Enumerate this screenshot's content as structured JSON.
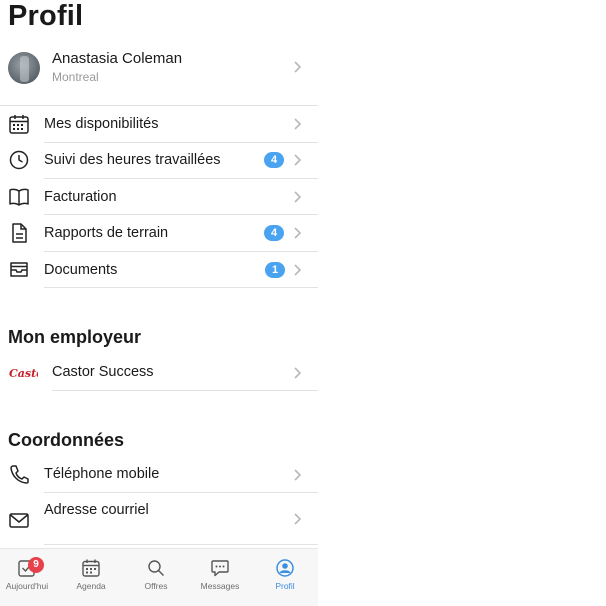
{
  "page": {
    "title": "Profil"
  },
  "profile": {
    "name": "Anastasia Coleman",
    "city": "Montreal"
  },
  "menu": [
    {
      "label": "Mes disponibilités",
      "icon": "calendar-icon",
      "badge": null
    },
    {
      "label": "Suivi des heures travaillées",
      "icon": "clock-icon",
      "badge": "4"
    },
    {
      "label": "Facturation",
      "icon": "book-icon",
      "badge": null
    },
    {
      "label": "Rapports de terrain",
      "icon": "document-icon",
      "badge": "4"
    },
    {
      "label": "Documents",
      "icon": "inbox-icon",
      "badge": "1"
    }
  ],
  "employer": {
    "heading": "Mon employeur",
    "name": "Castor Success",
    "logo_text": "Castor"
  },
  "contact": {
    "heading": "Coordonnées",
    "items": [
      {
        "label": "Téléphone mobile",
        "icon": "phone-icon"
      },
      {
        "label": "Adresse courriel",
        "icon": "mail-icon"
      }
    ]
  },
  "tabbar": {
    "tabs": [
      {
        "label": "Aujourd'hui",
        "icon": "checkbox-icon",
        "badge": "9",
        "active": false
      },
      {
        "label": "Agenda",
        "icon": "calendar-icon",
        "active": false
      },
      {
        "label": "Offres",
        "icon": "search-icon",
        "active": false
      },
      {
        "label": "Messages",
        "icon": "chat-icon",
        "active": false
      },
      {
        "label": "Profil",
        "icon": "profile-icon",
        "active": true
      }
    ]
  },
  "colors": {
    "accent": "#3b8fe0",
    "badge_blue": "#4aa3f0",
    "badge_red": "#e8414b",
    "logo_red": "#c8202a"
  }
}
